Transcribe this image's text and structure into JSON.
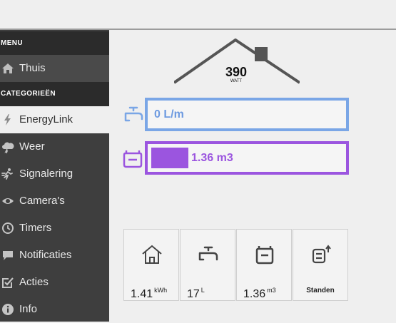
{
  "sidebar": {
    "menu_header": "MENU",
    "categories_header": "CATEGORIEËN",
    "items": [
      {
        "label": "Thuis",
        "icon": "home-icon"
      },
      {
        "label": "EnergyLink",
        "icon": "lightning-icon"
      },
      {
        "label": "Weer",
        "icon": "cloud-icon"
      },
      {
        "label": "Signalering",
        "icon": "running-person-icon"
      },
      {
        "label": "Camera's",
        "icon": "eye-icon"
      },
      {
        "label": "Timers",
        "icon": "clock-icon"
      },
      {
        "label": "Notificaties",
        "icon": "speech-bubble-icon"
      },
      {
        "label": "Acties",
        "icon": "checkbox-icon"
      },
      {
        "label": "Info",
        "icon": "info-icon"
      }
    ],
    "active_item": "EnergyLink"
  },
  "power": {
    "value": "390",
    "unit": "WATT"
  },
  "water_meter": {
    "value": "0 L/m",
    "color": "#7aa6e6"
  },
  "gas_meter": {
    "value": "1.36 m3",
    "color": "#9b55df"
  },
  "tiles": [
    {
      "icon": "home-icon",
      "value": "1.41",
      "unit": "kWh"
    },
    {
      "icon": "faucet-icon",
      "value": "17",
      "unit": "L"
    },
    {
      "icon": "gas-meter-icon",
      "value": "1.36",
      "unit": "m3"
    },
    {
      "icon": "meter-readings-icon",
      "label": "Standen"
    }
  ]
}
